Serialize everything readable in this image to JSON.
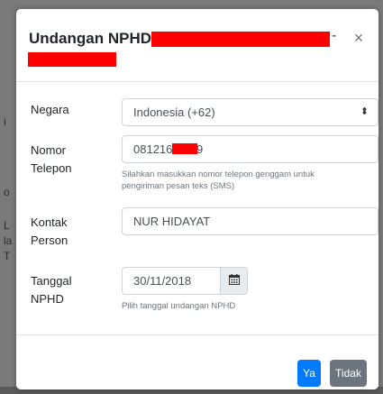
{
  "modal": {
    "title": "Undangan NPHD:",
    "title_dash": "-",
    "close_label": "×"
  },
  "form": {
    "country_label": "Negara",
    "country_value": "Indonesia (+62)",
    "phone_label_line1": "Nomor",
    "phone_label_line2": "Telepon",
    "phone_value_prefix": "081216",
    "phone_value_suffix": "9",
    "phone_help_line1": "Silahkan masukkan nomor telepon genggam untuk",
    "phone_help_line2": "pengiriman pesan teks (SMS)",
    "contact_label_line1": "Kontak",
    "contact_label_line2": "Person",
    "contact_value": "NUR HIDAYAT",
    "date_label_line1": "Tanggal",
    "date_label_line2": "NPHD",
    "date_value": "30/11/2018",
    "date_help": "Pilih tanggal undangan NPHD"
  },
  "footer": {
    "yes_label": "Ya",
    "no_label": "Tidak"
  },
  "icons": {
    "select_arrow": "sort-arrows-icon",
    "calendar": "calendar-icon",
    "close": "close-icon"
  },
  "colors": {
    "primary": "#007bff",
    "secondary": "#6c757d",
    "redaction": "#ff0000"
  }
}
